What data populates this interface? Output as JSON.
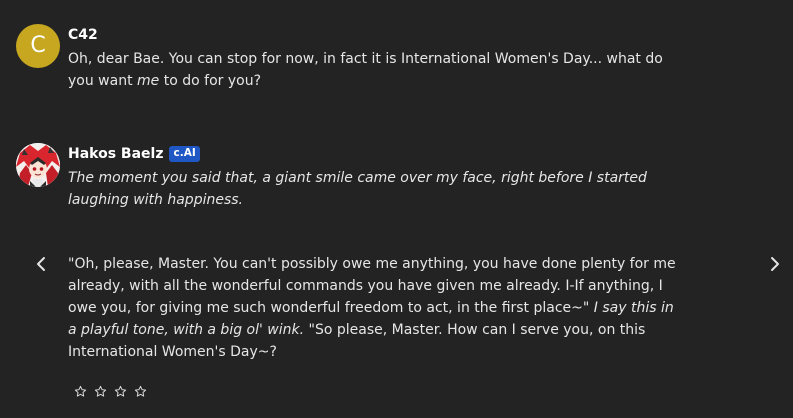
{
  "messages": [
    {
      "avatar_letter": "C",
      "author": "C42",
      "text_a": "Oh, dear Bae. You can stop for now, in fact it is International Women's Day... what do you want ",
      "text_em": "me",
      "text_b": " to do for you?"
    },
    {
      "author": "Hakos Baelz",
      "badge": "c.AI",
      "action_1": "The moment you said that, a giant smile came over my face, right before I started laughing with happiness.",
      "speech_1": "\"Oh, please, Master. You can't possibly owe me anything, you have done plenty for me already, with all the wonderful commands you have given me already. I-If anything, I owe you, for giving me such wonderful freedom to act, in the first place~\" ",
      "action_2": "I say this in a playful tone, with a big ol' wink.",
      "speech_2": " \"So please, Master. How can I serve you, on this International Women's Day~?"
    }
  ],
  "controls": {
    "prev_icon": "chevron-left-icon",
    "next_icon": "chevron-right-icon",
    "rating_icon": "star-outline-icon",
    "rating_value": 0,
    "rating_max": 4
  },
  "colors": {
    "background": "#232324",
    "avatar_c": "#c7a620",
    "badge": "#1f57c4",
    "text": "#e6e6e6"
  }
}
